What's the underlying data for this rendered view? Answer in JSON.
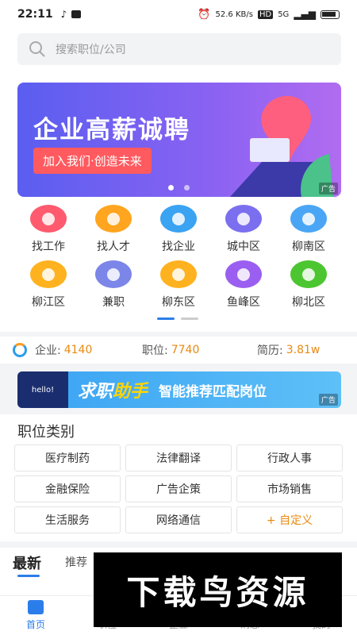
{
  "status": {
    "time": "22:11",
    "speed": "52.6 KB/s",
    "hd": "HD",
    "net": "5G"
  },
  "search": {
    "placeholder": "搜索职位/公司"
  },
  "banner": {
    "title": "企业高薪诚聘",
    "slogan": "加入我们·创造未来",
    "ad": "广告"
  },
  "grid": [
    {
      "label": "找工作",
      "icon": "briefcase-icon",
      "color": "#ff5a6e"
    },
    {
      "label": "找人才",
      "icon": "person-icon",
      "color": "#ffa51f"
    },
    {
      "label": "找企业",
      "icon": "building-icon",
      "color": "#3aa3f2"
    },
    {
      "label": "城中区",
      "icon": "location-pin-icon",
      "color": "#7b6ff0"
    },
    {
      "label": "柳南区",
      "icon": "location-pin-icon",
      "color": "#4aa6f5"
    },
    {
      "label": "柳江区",
      "icon": "location-pin-icon",
      "color": "#ffb21f"
    },
    {
      "label": "兼职",
      "icon": "money-bag-icon",
      "color": "#7c86e8"
    },
    {
      "label": "柳东区",
      "icon": "location-pin-icon",
      "color": "#ffb21f"
    },
    {
      "label": "鱼峰区",
      "icon": "location-pin-icon",
      "color": "#9a5ff0"
    },
    {
      "label": "柳北区",
      "icon": "location-pin-icon",
      "color": "#4cc630"
    }
  ],
  "stats": {
    "company_k": "企业:",
    "company_v": "4140",
    "job_k": "职位:",
    "job_v": "7740",
    "resume_k": "简历:",
    "resume_v": "3.81w"
  },
  "helper": {
    "robot": "hello!",
    "title_a": "求职",
    "title_b": "助手",
    "subtitle": "智能推荐匹配岗位",
    "ad": "广告"
  },
  "category": {
    "title": "职位类别",
    "items": [
      "医疗制药",
      "法律翻译",
      "行政人事",
      "金融保险",
      "广告企策",
      "市场销售",
      "生活服务",
      "网络通信",
      "+ 自定义"
    ]
  },
  "tabs": {
    "latest": "最新",
    "recommend": "推荐"
  },
  "watermark": "下载鸟资源",
  "nav": [
    {
      "label": "首页",
      "icon": "home-icon",
      "active": true
    },
    {
      "label": "职位",
      "icon": "briefcase-icon",
      "active": false
    },
    {
      "label": "企业",
      "icon": "building-icon",
      "active": false
    },
    {
      "label": "消息",
      "icon": "message-icon",
      "active": false
    },
    {
      "label": "我的",
      "icon": "user-icon",
      "active": false
    }
  ]
}
